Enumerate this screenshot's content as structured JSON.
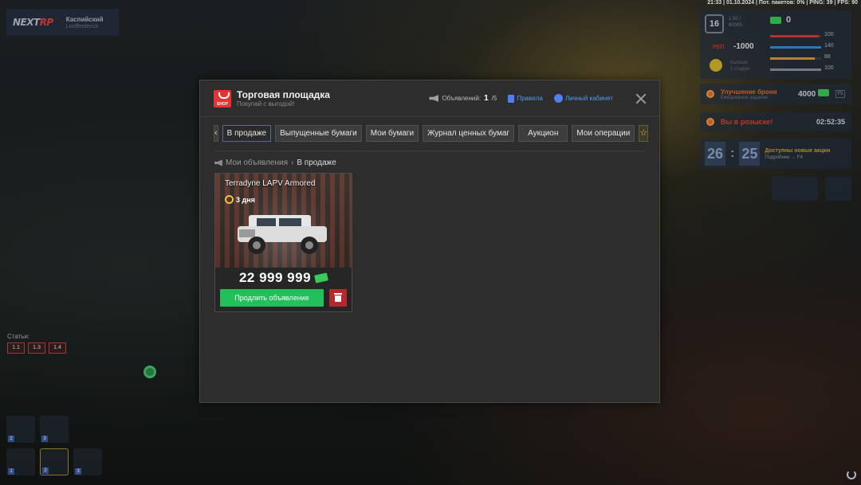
{
  "status_bar": "21:33 | 01.10.2024 | Пот. пакетов: 0% | PING: 39 | FPS: 90",
  "server": {
    "logo_prefix": "NEXT",
    "logo_suffix": "RP",
    "name": "Каспийский",
    "sub": "Lordfrederick"
  },
  "hud": {
    "level": "16",
    "exp": "1 50 /\n60000",
    "money": "0",
    "rep_label": "РЕП",
    "rep_value": "-1000",
    "skull_text": "Калаши\n1 стадия",
    "bars": [
      {
        "value": "100",
        "color": "#d63a3a",
        "fill": 0.95
      },
      {
        "value": "140",
        "color": "#3a8ad6",
        "fill": 1.0
      },
      {
        "value": "88",
        "color": "#d69a3a",
        "fill": 0.88
      },
      {
        "value": "100",
        "color": "#8890a0",
        "fill": 1.0
      }
    ],
    "armor": {
      "title": "Улучшение брони",
      "sub": "Ежедневное задание",
      "reward": "4000",
      "key": "F5"
    },
    "wanted": {
      "text": "Вы в розыске!",
      "timer": "02:52:35"
    },
    "event": {
      "hours": "26",
      "minutes": "25",
      "title": "Доступны новые акции",
      "sub": "Подробнее →",
      "key": "F4"
    },
    "articles_label": "Статьи:",
    "articles": [
      "1.1",
      "1.3",
      "1.4"
    ]
  },
  "market": {
    "title": "Торговая площадка",
    "subtitle": "Покупай с выгодой!",
    "shop_badge": "SHOP",
    "ads_label": "Объявлений:",
    "ads_current": "1",
    "ads_max": "/5",
    "rules_label": "Правила",
    "cabinet_label": "Личный кабинет",
    "tabs": [
      "В продаже",
      "Выпущенные бумаги",
      "Мои бумаги",
      "Журнал ценных бумаг",
      "Аукцион",
      "Мои операции"
    ],
    "active_tab": 0,
    "breadcrumb": {
      "parent": "Мои объявления",
      "separator": "›",
      "current": "В продаже"
    },
    "listing": {
      "title": "Terradyne LAPV Armored",
      "time_left": "3 дня",
      "price": "22 999 999",
      "extend_label": "Продлить объявление"
    }
  }
}
